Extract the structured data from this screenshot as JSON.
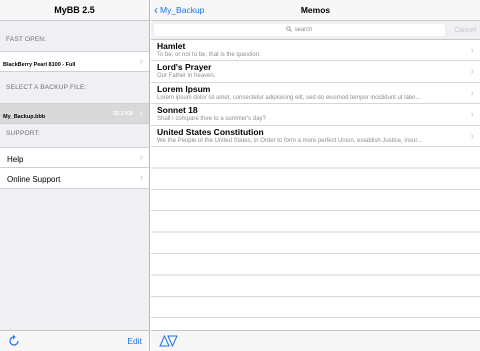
{
  "left": {
    "title": "MyBB 2.5",
    "fast_open_header": "FAST OPEN:",
    "fast_open_item": "BlackBerry Pearl 8100 - Full",
    "backup_header": "SELECT A BACKUP FILE:",
    "backup_file": "My_Backup.bbb",
    "backup_size": "32.3 KB",
    "support_header": "SUPPORT:",
    "support_items": [
      "Help",
      "Online Support"
    ],
    "edit_label": "Edit",
    "refresh_icon": "refresh-icon"
  },
  "right": {
    "back_label": "My_Backup",
    "title": "Memos",
    "search_placeholder": "search",
    "cancel_label": "Cancel",
    "memos": [
      {
        "title": "Hamlet",
        "subtitle": "To be, or not to be, that is the question:"
      },
      {
        "title": "Lord's Prayer",
        "subtitle": "Our Father in heaven,"
      },
      {
        "title": "Lorem Ipsum",
        "subtitle": "Lorem ipsum dolor sit amet, consectetur adipisicing elit, sed do eiusmod tempor incididunt ut labo..."
      },
      {
        "title": "Sonnet 18",
        "subtitle": "Shall I compare thee to a summer's day?"
      },
      {
        "title": "United States Constitution",
        "subtitle": "We the People of the United States, in Order to form a more perfect Union, establish Justice, insur..."
      }
    ],
    "sort_icon": "sort-triangles-icon"
  },
  "colors": {
    "accent": "#1a73e8",
    "panel_bg": "#efeff4",
    "bar_bg": "#f7f7f8",
    "chevron": "#c7c7cc"
  }
}
